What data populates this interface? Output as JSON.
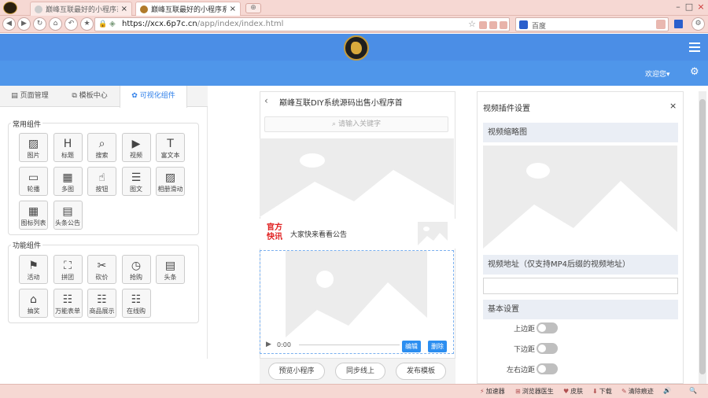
{
  "browser": {
    "tabs": [
      {
        "title": "巅峰互联最好的小程序系统"
      },
      {
        "title": "巅峰互联最好的小程序系统"
      }
    ],
    "new_tab_glyph": "⊕",
    "url_main": "https://xcx.6p7c.cn",
    "url_path": "/app/index/index.html",
    "search_engine": "百度"
  },
  "header": {
    "welcome": "欢迎您▾"
  },
  "left": {
    "tabs": [
      "页面管理",
      "模板中心",
      "可视化组件"
    ],
    "groups": [
      {
        "title": "常用组件",
        "items": [
          {
            "label": "图片",
            "icon": "image-icon"
          },
          {
            "label": "标题",
            "icon": "heading-icon"
          },
          {
            "label": "搜索",
            "icon": "search-icon"
          },
          {
            "label": "视频",
            "icon": "video-icon"
          },
          {
            "label": "富文本",
            "icon": "text-icon"
          },
          {
            "label": "轮播",
            "icon": "carousel-icon"
          },
          {
            "label": "多图",
            "icon": "multi-image-icon"
          },
          {
            "label": "按钮",
            "icon": "button-icon"
          },
          {
            "label": "图文",
            "icon": "image-text-icon"
          },
          {
            "label": "相册滑动",
            "icon": "album-icon"
          },
          {
            "label": "图标列表",
            "icon": "grid-icon"
          },
          {
            "label": "头条公告",
            "icon": "headline-icon"
          }
        ]
      },
      {
        "title": "功能组件",
        "items": [
          {
            "label": "活动",
            "icon": "flag-icon"
          },
          {
            "label": "拼团",
            "icon": "group-buy-icon"
          },
          {
            "label": "砍价",
            "icon": "bargain-icon"
          },
          {
            "label": "抢购",
            "icon": "clock-icon"
          },
          {
            "label": "头条",
            "icon": "news-icon"
          },
          {
            "label": "抽奖",
            "icon": "shop-icon"
          },
          {
            "label": "万能表单",
            "icon": "form-icon"
          },
          {
            "label": "商品展示",
            "icon": "product-icon"
          },
          {
            "label": "在线购",
            "icon": "cart-icon"
          }
        ]
      }
    ]
  },
  "phone": {
    "title": "巅峰互联DIY系统源码出售小程序首",
    "search_placeholder": "请输入关键字",
    "notice_logo": "官方快讯",
    "notice_text": "大家快来看看公告",
    "video_time": "0:00",
    "edit_label": "编辑",
    "delete_label": "删除",
    "footer_buttons": [
      "预览小程序",
      "同步线上",
      "发布模板"
    ]
  },
  "right": {
    "title": "视频插件设置",
    "close": "×",
    "thumb_section": "视频缩略图",
    "url_section": "视频地址（仅支持MP4后缀的视频地址）",
    "basic_section": "基本设置",
    "switches": [
      "上边距",
      "下边距",
      "左右边距"
    ]
  },
  "status": {
    "items": [
      "加速器",
      "浏览器医生",
      "皮肤",
      "下载",
      "清除痕迹"
    ]
  }
}
